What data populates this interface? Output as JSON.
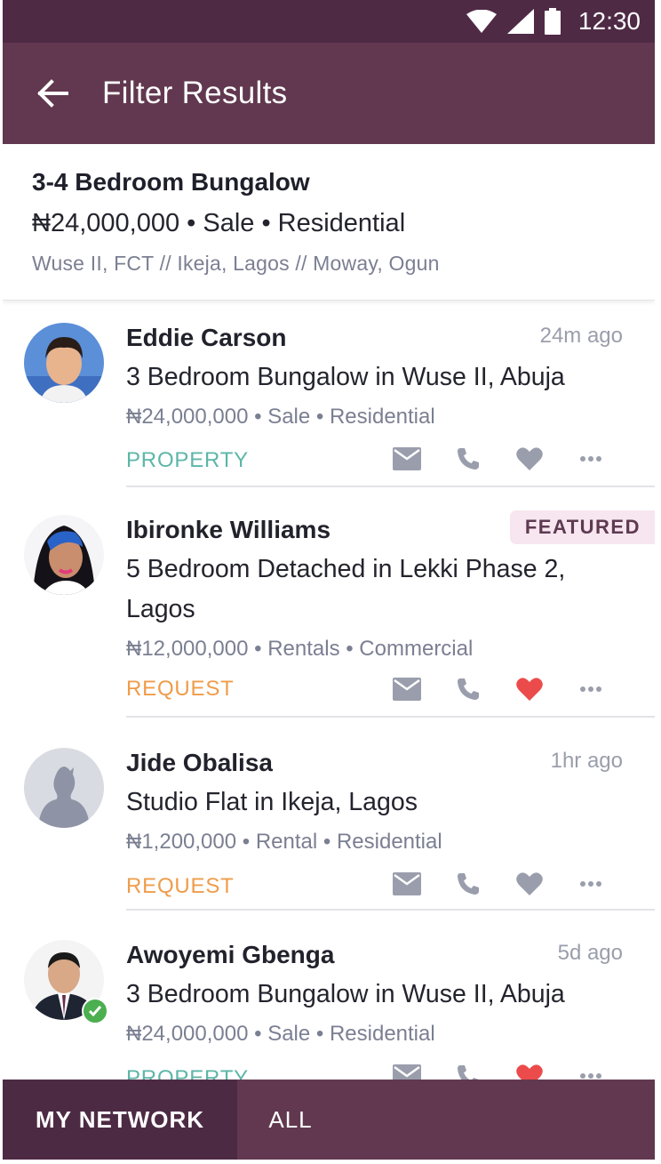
{
  "status_bar": {
    "time": "12:30",
    "icons": [
      "wifi-icon",
      "signal-icon",
      "battery-icon"
    ]
  },
  "header": {
    "title": "Filter Results",
    "back_icon": "arrow-left-icon"
  },
  "search_summary": {
    "title": "3-4 Bedroom Bungalow",
    "details": "₦24,000,000 • Sale • Residential",
    "locations": "Wuse II, FCT // Ikeja, Lagos // Moway, Ogun"
  },
  "listings": [
    {
      "name": "Eddie Carson",
      "time": "24m ago",
      "title": "3 Bedroom Bungalow in Wuse II, Abuja",
      "meta": "₦24,000,000 • Sale • Residential",
      "tag": "PROPERTY",
      "favorited": false
    },
    {
      "name": "Ibironke Williams",
      "badge": "FEATURED",
      "title": "5 Bedroom Detached in Lekki Phase 2, Lagos",
      "meta": "₦12,000,000 • Rentals • Commercial",
      "tag": "REQUEST",
      "favorited": true
    },
    {
      "name": "Jide Obalisa",
      "time": "1hr ago",
      "title": "Studio Flat in Ikeja, Lagos",
      "meta": "₦1,200,000 • Rental • Residential",
      "tag": "REQUEST",
      "favorited": false
    },
    {
      "name": "Awoyemi Gbenga",
      "time": "5d ago",
      "title": "3 Bedroom Bungalow in Wuse II, Abuja",
      "meta": "₦24,000,000 • Sale • Residential",
      "tag": "PROPERTY",
      "favorited": true,
      "verified": true
    }
  ],
  "bottom_tabs": {
    "active": "MY NETWORK",
    "other": "ALL"
  },
  "colors": {
    "header": "#61384f",
    "status_bar": "#4f2a45",
    "property_tag": "#5cb6a8",
    "request_tag": "#ef9c4a",
    "heart_active": "#ec4b4b",
    "icon_gray": "#9a9eac"
  }
}
